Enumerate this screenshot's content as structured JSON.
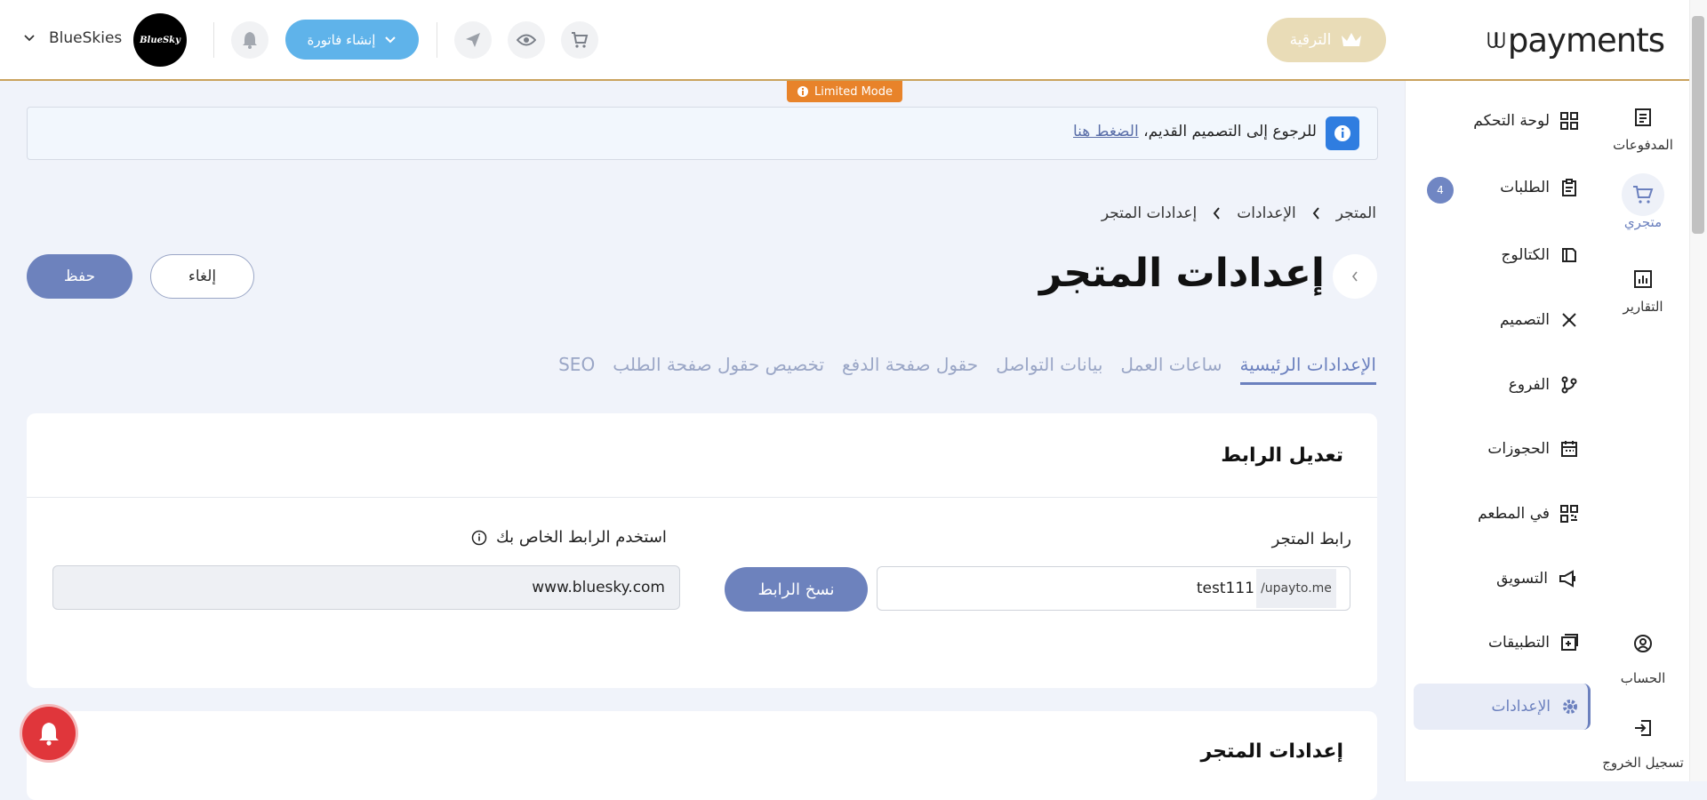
{
  "header": {
    "logo_text": "payments",
    "upgrade_label": "الترقية",
    "invoice_label": "إنشاء فاتورة",
    "username": "BlueSkies",
    "avatar_text": "BlueSky"
  },
  "sidebar": {
    "rail": [
      {
        "label": "المدفوعات",
        "icon": "payments-icon"
      },
      {
        "label": "متجري",
        "icon": "cart-icon"
      },
      {
        "label": "التقارير",
        "icon": "chart-icon"
      },
      {
        "label": "الحساب",
        "icon": "account-icon"
      },
      {
        "label": "تسجيل الخروج",
        "icon": "logout-icon"
      }
    ],
    "menu": [
      {
        "label": "لوحة التحكم",
        "icon": "grid-icon"
      },
      {
        "label": "الطلبات",
        "icon": "clipboard-icon",
        "badge": "4"
      },
      {
        "label": "الكتالوج",
        "icon": "catalog-icon"
      },
      {
        "label": "التصميم",
        "icon": "design-icon"
      },
      {
        "label": "الفروع",
        "icon": "branch-icon"
      },
      {
        "label": "الحجوزات",
        "icon": "calendar-icon"
      },
      {
        "label": "في المطعم",
        "icon": "qr-icon"
      },
      {
        "label": "التسويق",
        "icon": "megaphone-icon"
      },
      {
        "label": "التطبيقات",
        "icon": "apps-icon"
      },
      {
        "label": "الإعدادات",
        "icon": "gear-icon"
      }
    ]
  },
  "limited_mode": "Limited Mode",
  "notice": {
    "text": "للرجوع إلى التصميم القديم،",
    "link": "الضغط هنا"
  },
  "breadcrumb": [
    "المتجر",
    "الإعدادات",
    "إعدادات المتجر"
  ],
  "page_title": "إعدادات المتجر",
  "actions": {
    "save": "حفظ",
    "cancel": "إلغاء"
  },
  "tabs": [
    "الإعدادات الرئيسية",
    "ساعات العمل",
    "بيانات التواصل",
    "حقول صفحة الدفع",
    "تخصيص حقول صفحة الطلب",
    "SEO"
  ],
  "link_card": {
    "title": "تعديل الرابط",
    "store_link_label": "رابط المتجر",
    "store_link_prefix": "/upayto.me",
    "store_link_value": "test111",
    "copy_label": "نسخ الرابط",
    "custom_domain_label": "استخدم الرابط الخاص بك",
    "custom_domain_value": "www.bluesky.com"
  },
  "settings_card": {
    "title": "إعدادات المتجر"
  },
  "colors": {
    "accent": "#6d82bd",
    "gold": "#e9dcb7",
    "info_blue": "#2f7de0",
    "orange": "#e8832a",
    "alert_red": "#e0363b"
  }
}
